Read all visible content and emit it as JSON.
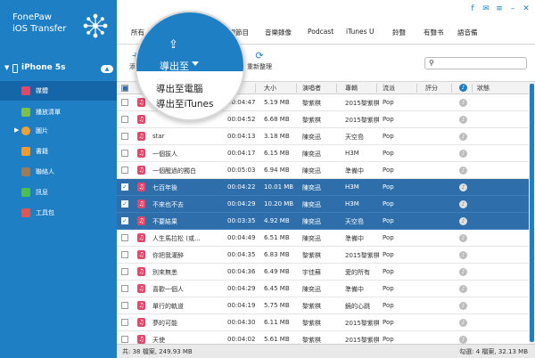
{
  "app": {
    "name_line1": "FonePaw",
    "name_line2": "iOS Transfer"
  },
  "window_icons": [
    "facebook-icon",
    "chat-icon",
    "menu-icon",
    "minimize-icon",
    "close-icon"
  ],
  "window_icon_glyphs": [
    "f",
    "✉",
    "≡",
    "–",
    "✕"
  ],
  "device": {
    "name": "iPhone 5s"
  },
  "sidebar": {
    "items": [
      {
        "label": "媒體",
        "icon": "music-icon",
        "color": "#e1486a"
      },
      {
        "label": "播放清單",
        "icon": "playlist-icon",
        "color": "#7cc24a"
      },
      {
        "label": "圖片",
        "icon": "photo-icon",
        "color": "#f0a030"
      },
      {
        "label": "書籍",
        "icon": "book-icon",
        "color": "#f29a2e"
      },
      {
        "label": "聯絡人",
        "icon": "contacts-icon",
        "color": "#9c7b56"
      },
      {
        "label": "訊息",
        "icon": "message-icon",
        "color": "#4cc04c"
      },
      {
        "label": "工具包",
        "icon": "toolbox-icon",
        "color": "#e25555"
      }
    ]
  },
  "tabs": [
    "所有",
    "音樂",
    "電影",
    "電視節目",
    "音樂錄像",
    "Podcast",
    "iTunes U",
    "鈴聲",
    "有聲书",
    "語音備"
  ],
  "toolbar": {
    "add_label": "添加",
    "delete_label": "刪除",
    "reorganize_label": "重新整理",
    "search_placeholder": ""
  },
  "export_menu": {
    "button_label": "導出至",
    "items": [
      "導出至電腦",
      "導出至iTunes"
    ]
  },
  "columns": [
    "名稱",
    "時間",
    "大小",
    "演唱者",
    "專輯",
    "流派",
    "評分",
    "",
    "狀態"
  ],
  "rows": [
    {
      "checked": false,
      "selected": false,
      "name": "",
      "time": "00:04:47",
      "size": "5.19 MB",
      "artist": "黎紫棋",
      "album": "2015黎紫棋...",
      "genre": "Pop"
    },
    {
      "checked": false,
      "selected": false,
      "name": "",
      "time": "00:04:52",
      "size": "6.68 MB",
      "artist": "黎紫棋",
      "album": "2015黎紫棋...",
      "genre": "Pop"
    },
    {
      "checked": false,
      "selected": false,
      "name": "star",
      "time": "00:04:13",
      "size": "3.18 MB",
      "artist": "陳奕迅",
      "album": "天空島",
      "genre": "Pop"
    },
    {
      "checked": false,
      "selected": false,
      "name": "一個拔人",
      "time": "00:04:17",
      "size": "6.15 MB",
      "artist": "陳奕迅",
      "album": "H3M",
      "genre": "Pop"
    },
    {
      "checked": false,
      "selected": false,
      "name": "一個醒過的獨白",
      "time": "00:05:03",
      "size": "6.94 MB",
      "artist": "陳奕迅",
      "album": "準備中",
      "genre": "Pop"
    },
    {
      "checked": true,
      "selected": true,
      "name": "七百年後",
      "time": "00:04:22",
      "size": "10.01 MB",
      "artist": "陳奕迅",
      "album": "H3M",
      "genre": "Pop"
    },
    {
      "checked": true,
      "selected": true,
      "name": "不來也不去",
      "time": "00:04:29",
      "size": "10.20 MB",
      "artist": "陳奕迅",
      "album": "H3M",
      "genre": "Pop"
    },
    {
      "checked": true,
      "selected": true,
      "name": "不要結果",
      "time": "00:03:35",
      "size": "4.92 MB",
      "artist": "陳奕迅",
      "album": "天空島",
      "genre": "Pop"
    },
    {
      "checked": false,
      "selected": false,
      "name": "人生馬拉松 (或...",
      "time": "00:04:49",
      "size": "6.51 MB",
      "artist": "陳奕迅",
      "album": "準備中",
      "genre": "Pop"
    },
    {
      "checked": false,
      "selected": false,
      "name": "你把我灌醉",
      "time": "00:04:35",
      "size": "6.83 MB",
      "artist": "黎紫棋",
      "album": "2015黎紫棋...",
      "genre": "Pop"
    },
    {
      "checked": false,
      "selected": false,
      "name": "別來無恙",
      "time": "00:04:36",
      "size": "6.49 MB",
      "artist": "宇佳蘇",
      "album": "愛的所有",
      "genre": "Pop"
    },
    {
      "checked": false,
      "selected": false,
      "name": "喜歡一個人",
      "time": "00:04:29",
      "size": "6.45 MB",
      "artist": "陳奕迅",
      "album": "準備中",
      "genre": "Pop"
    },
    {
      "checked": false,
      "selected": false,
      "name": "單行的軌道",
      "time": "00:04:19",
      "size": "5.75 MB",
      "artist": "黎紫棋",
      "album": "鏡的心跳",
      "genre": "Pop"
    },
    {
      "checked": false,
      "selected": false,
      "name": "夢的可能",
      "time": "00:04:30",
      "size": "6.11 MB",
      "artist": "黎紫棋",
      "album": "2015黎紫棋...",
      "genre": "Pop"
    },
    {
      "checked": false,
      "selected": false,
      "name": "天使",
      "time": "00:04:02",
      "size": "5.61 MB",
      "artist": "黎紫棋",
      "album": "2015黎紫棋...",
      "genre": "Pop"
    },
    {
      "checked": false,
      "selected": false,
      "name": "太陽照常升起",
      "time": "00:05:14",
      "size": "7.76 MB",
      "artist": "陳奕迅",
      "album": "H3M",
      "genre": "Pop"
    }
  ],
  "status": {
    "total": "共: 38 檔案, 249.93 MB",
    "checked": "勾選: 4 檔案, 32.13 MB"
  },
  "colors": {
    "sidebar": "#1f7fc4",
    "selection": "#2d6eab",
    "music": "#e1486a"
  }
}
